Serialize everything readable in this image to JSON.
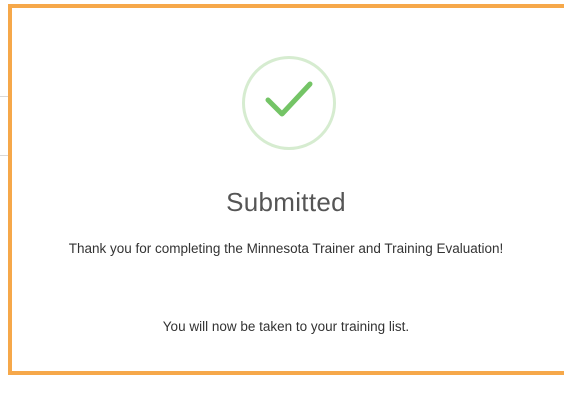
{
  "dialog": {
    "icon": "checkmark-icon",
    "title": "Submitted",
    "message": "Thank you for completing the Minnesota Trainer and Training Evaluation!",
    "redirect_note": "You will now be taken to your training list."
  },
  "colors": {
    "modal_border": "#f6a84a",
    "check_ring": "#d6ecd0",
    "check_mark": "#74c466",
    "title_text": "#555555",
    "body_text": "#333333"
  }
}
